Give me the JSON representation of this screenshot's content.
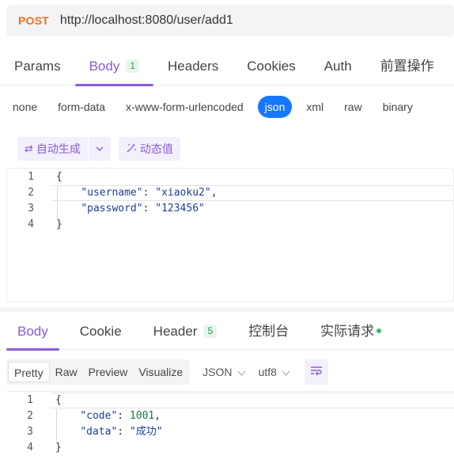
{
  "request": {
    "method": "POST",
    "url": "http://localhost:8080/user/add1"
  },
  "request_tabs": [
    {
      "label": "Params"
    },
    {
      "label": "Body",
      "badge": "1"
    },
    {
      "label": "Headers"
    },
    {
      "label": "Cookies"
    },
    {
      "label": "Auth"
    },
    {
      "label": "前置操作"
    }
  ],
  "body_types": [
    "none",
    "form-data",
    "x-www-form-urlencoded",
    "json",
    "xml",
    "raw",
    "binary"
  ],
  "body_type_selected": "json",
  "toolbar": {
    "auto_generate": "自动生成",
    "dynamic_value": "动态值"
  },
  "request_body": {
    "line_numbers": [
      "1",
      "2",
      "3",
      "4"
    ],
    "l1": "{",
    "username_key": "\"username\"",
    "username_value": "\"xiaoku2\"",
    "password_key": "\"password\"",
    "password_value": "\"123456\"",
    "l4": "}"
  },
  "response_tabs": [
    {
      "label": "Body"
    },
    {
      "label": "Cookie"
    },
    {
      "label": "Header",
      "badge": "5"
    },
    {
      "label": "控制台"
    },
    {
      "label": "实际请求"
    }
  ],
  "view_modes": [
    "Pretty",
    "Raw",
    "Preview",
    "Visualize"
  ],
  "format_select": "JSON",
  "encoding_select": "utf8",
  "response_body": {
    "line_numbers": [
      "1",
      "2",
      "3",
      "4"
    ],
    "l1": "{",
    "code_key": "\"code\"",
    "code_value": "1001",
    "data_key": "\"data\"",
    "data_value": "\"成功\"",
    "l4": "}"
  },
  "colors": {
    "accent": "#8a5cd6",
    "method": "#f2711c",
    "json_selected": "#1677ff",
    "badge_green": "#2e9e58"
  },
  "icons": {
    "auto_generate": "refresh-icon",
    "dynamic_value": "magic-wand-icon",
    "wrap": "wrap-lines-icon"
  }
}
